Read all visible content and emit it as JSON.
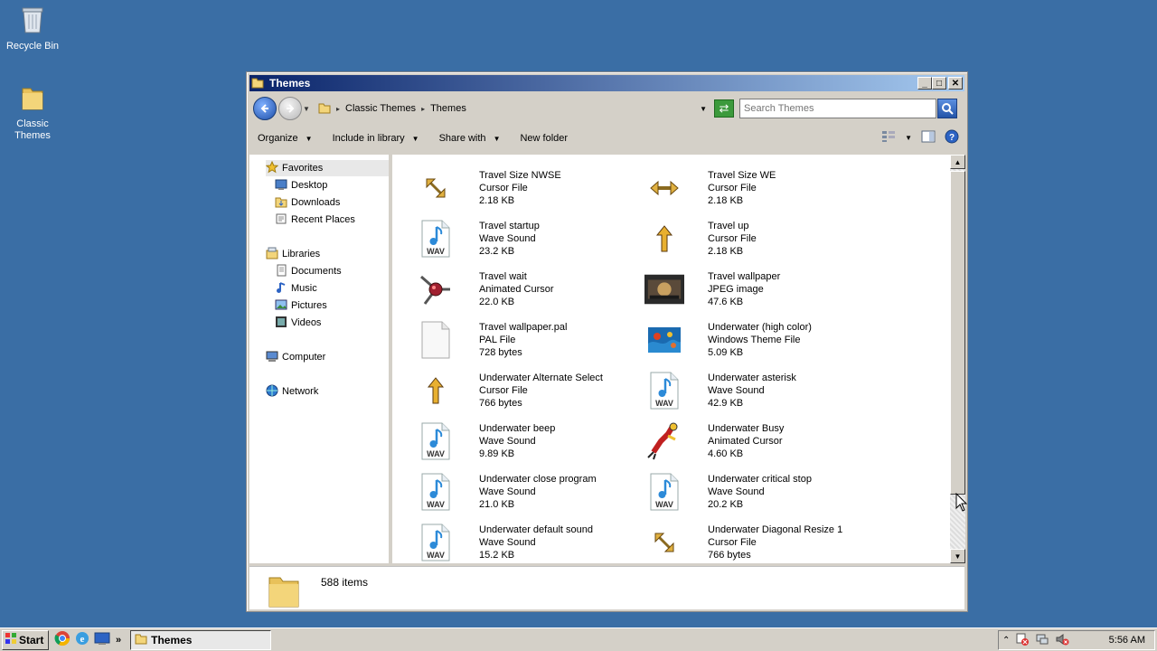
{
  "desktop": {
    "icons": [
      {
        "label": "Recycle Bin",
        "icon": "recycle-bin-icon"
      },
      {
        "label": "Classic Themes",
        "icon": "folder-icon"
      }
    ]
  },
  "window": {
    "title": "Themes",
    "controls": {
      "minimize": "_",
      "maximize": "□",
      "close": "✕"
    }
  },
  "address": {
    "crumbs": [
      "Classic Themes",
      "Themes"
    ],
    "search_placeholder": "Search Themes"
  },
  "toolbar": {
    "organize": "Organize",
    "include": "Include in library",
    "share": "Share with",
    "new_folder": "New folder"
  },
  "nav": {
    "favorites": "Favorites",
    "fav_items": [
      "Desktop",
      "Downloads",
      "Recent Places"
    ],
    "libraries": "Libraries",
    "lib_items": [
      "Documents",
      "Music",
      "Pictures",
      "Videos"
    ],
    "computer": "Computer",
    "network": "Network"
  },
  "files": [
    {
      "name": "",
      "type": "",
      "size": "2.18 KB",
      "icon": "cursor-icon"
    },
    {
      "name": "",
      "type": "",
      "size": "2.18 KB",
      "icon": "cursor-icon"
    },
    {
      "name": "Travel Size NWSE",
      "type": "Cursor File",
      "size": "2.18 KB",
      "icon": "resize-diagonal-icon"
    },
    {
      "name": "Travel Size WE",
      "type": "Cursor File",
      "size": "2.18 KB",
      "icon": "resize-horizontal-icon"
    },
    {
      "name": "Travel startup",
      "type": "Wave Sound",
      "size": "23.2 KB",
      "icon": "wav-icon"
    },
    {
      "name": "Travel up",
      "type": "Cursor File",
      "size": "2.18 KB",
      "icon": "arrow-up-icon"
    },
    {
      "name": "Travel wait",
      "type": "Animated Cursor",
      "size": "22.0 KB",
      "icon": "animated-cursor-icon"
    },
    {
      "name": "Travel wallpaper",
      "type": "JPEG image",
      "size": "47.6 KB",
      "icon": "jpeg-thumbnail-icon"
    },
    {
      "name": "Travel wallpaper.pal",
      "type": "PAL File",
      "size": "728 bytes",
      "icon": "blank-file-icon"
    },
    {
      "name": "Underwater (high color)",
      "type": "Windows Theme File",
      "size": "5.09 KB",
      "icon": "theme-file-icon"
    },
    {
      "name": "Underwater Alternate Select",
      "type": "Cursor File",
      "size": "766 bytes",
      "icon": "arrow-up-icon"
    },
    {
      "name": "Underwater asterisk",
      "type": "Wave Sound",
      "size": "42.9 KB",
      "icon": "wav-icon"
    },
    {
      "name": "Underwater beep",
      "type": "Wave Sound",
      "size": "9.89 KB",
      "icon": "wav-icon"
    },
    {
      "name": "Underwater Busy",
      "type": "Animated Cursor",
      "size": "4.60 KB",
      "icon": "diver-cursor-icon"
    },
    {
      "name": "Underwater close program",
      "type": "Wave Sound",
      "size": "21.0 KB",
      "icon": "wav-icon"
    },
    {
      "name": "Underwater critical stop",
      "type": "Wave Sound",
      "size": "20.2 KB",
      "icon": "wav-icon"
    },
    {
      "name": "Underwater default sound",
      "type": "Wave Sound",
      "size": "15.2 KB",
      "icon": "wav-icon"
    },
    {
      "name": "Underwater Diagonal Resize 1",
      "type": "Cursor File",
      "size": "766 bytes",
      "icon": "resize-diagonal-icon"
    }
  ],
  "status": {
    "count": "588 items"
  },
  "taskbar": {
    "start": "Start",
    "task": "Themes",
    "clock": "5:56 AM"
  },
  "colors": {
    "desktop": "#3a6ea5",
    "titlebar_start": "#0a246a",
    "titlebar_end": "#a6caf0",
    "chrome": "#d4d0c8"
  }
}
